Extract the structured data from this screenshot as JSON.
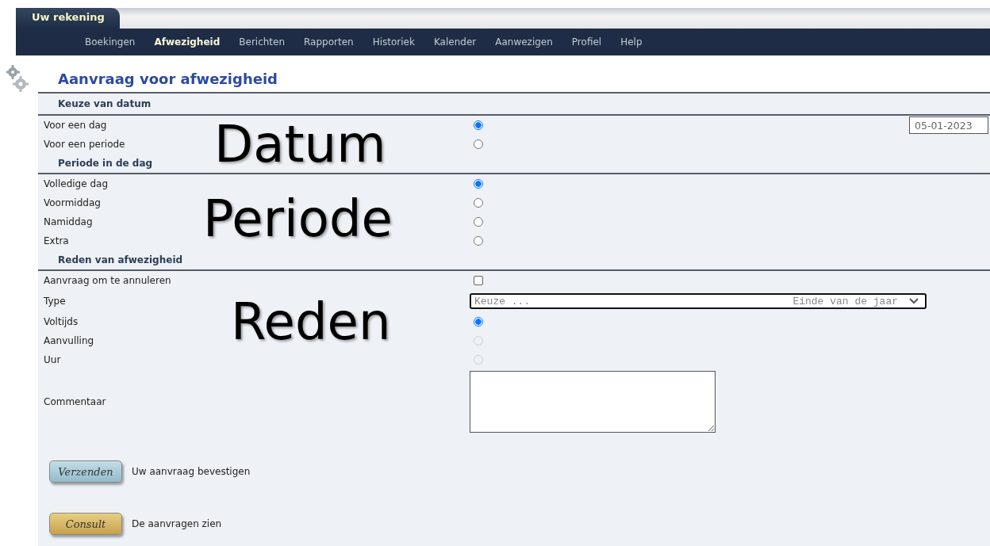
{
  "tab": {
    "label": "Uw rekening"
  },
  "nav": [
    {
      "label": "Boekingen",
      "selected": false
    },
    {
      "label": "Afwezigheid",
      "selected": true
    },
    {
      "label": "Berichten",
      "selected": false
    },
    {
      "label": "Rapporten",
      "selected": false
    },
    {
      "label": "Historiek",
      "selected": false
    },
    {
      "label": "Kalender",
      "selected": false
    },
    {
      "label": "Aanwezigen",
      "selected": false
    },
    {
      "label": "Profiel",
      "selected": false
    },
    {
      "label": "Help",
      "selected": false
    }
  ],
  "title": "Aanvraag voor afwezigheid",
  "sections": [
    {
      "title": "Keuze van datum",
      "annotation": "Datum",
      "date_field": {
        "value": "05-01-2023"
      },
      "rows": [
        {
          "label": "Voor een dag",
          "kind": "radio",
          "selected": true,
          "disabled": false
        },
        {
          "label": "Voor een periode",
          "kind": "radio",
          "selected": false,
          "disabled": false
        }
      ]
    },
    {
      "title": "Periode in de dag",
      "annotation": "Periode",
      "rows": [
        {
          "label": "Volledige dag",
          "kind": "radio",
          "selected": true,
          "disabled": false
        },
        {
          "label": "Voormiddag",
          "kind": "radio",
          "selected": false,
          "disabled": false
        },
        {
          "label": "Namiddag",
          "kind": "radio",
          "selected": false,
          "disabled": false
        },
        {
          "label": "Extra",
          "kind": "radio",
          "selected": false,
          "disabled": false
        }
      ]
    },
    {
      "title": "Reden van afwezigheid",
      "annotation": "Reden",
      "rows": [
        {
          "label": "Aanvraag om te annuleren",
          "kind": "checkbox",
          "checked": false
        },
        {
          "label": "Type",
          "kind": "select",
          "placeholder": "Keuze ...",
          "value": "Einde van de jaar"
        },
        {
          "label": "Voltijds",
          "kind": "radio",
          "selected": true,
          "disabled": false
        },
        {
          "label": "Aanvulling",
          "kind": "radio",
          "selected": false,
          "disabled": true
        },
        {
          "label": "Uur",
          "kind": "radio",
          "selected": false,
          "disabled": true
        },
        {
          "label": "Commentaar",
          "kind": "textarea"
        }
      ]
    }
  ],
  "actions": [
    {
      "label": "Verzenden",
      "hint": "Uw aanvraag bevestigen",
      "kind": "primary"
    },
    {
      "label": "Consult",
      "hint": "De aanvragen zien",
      "kind": "secondary"
    }
  ]
}
